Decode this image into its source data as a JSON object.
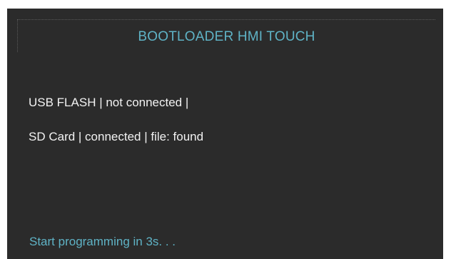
{
  "header": {
    "title": "BOOTLOADER HMI TOUCH"
  },
  "status": {
    "usb_flash": "USB FLASH | not connected |",
    "sd_card": "SD Card | connected | file: found"
  },
  "footer": {
    "message": "Start programming in 3s. . ."
  },
  "colors": {
    "background": "#2b2b2b",
    "accent": "#5fb3c6",
    "text": "#f2f2f2"
  }
}
